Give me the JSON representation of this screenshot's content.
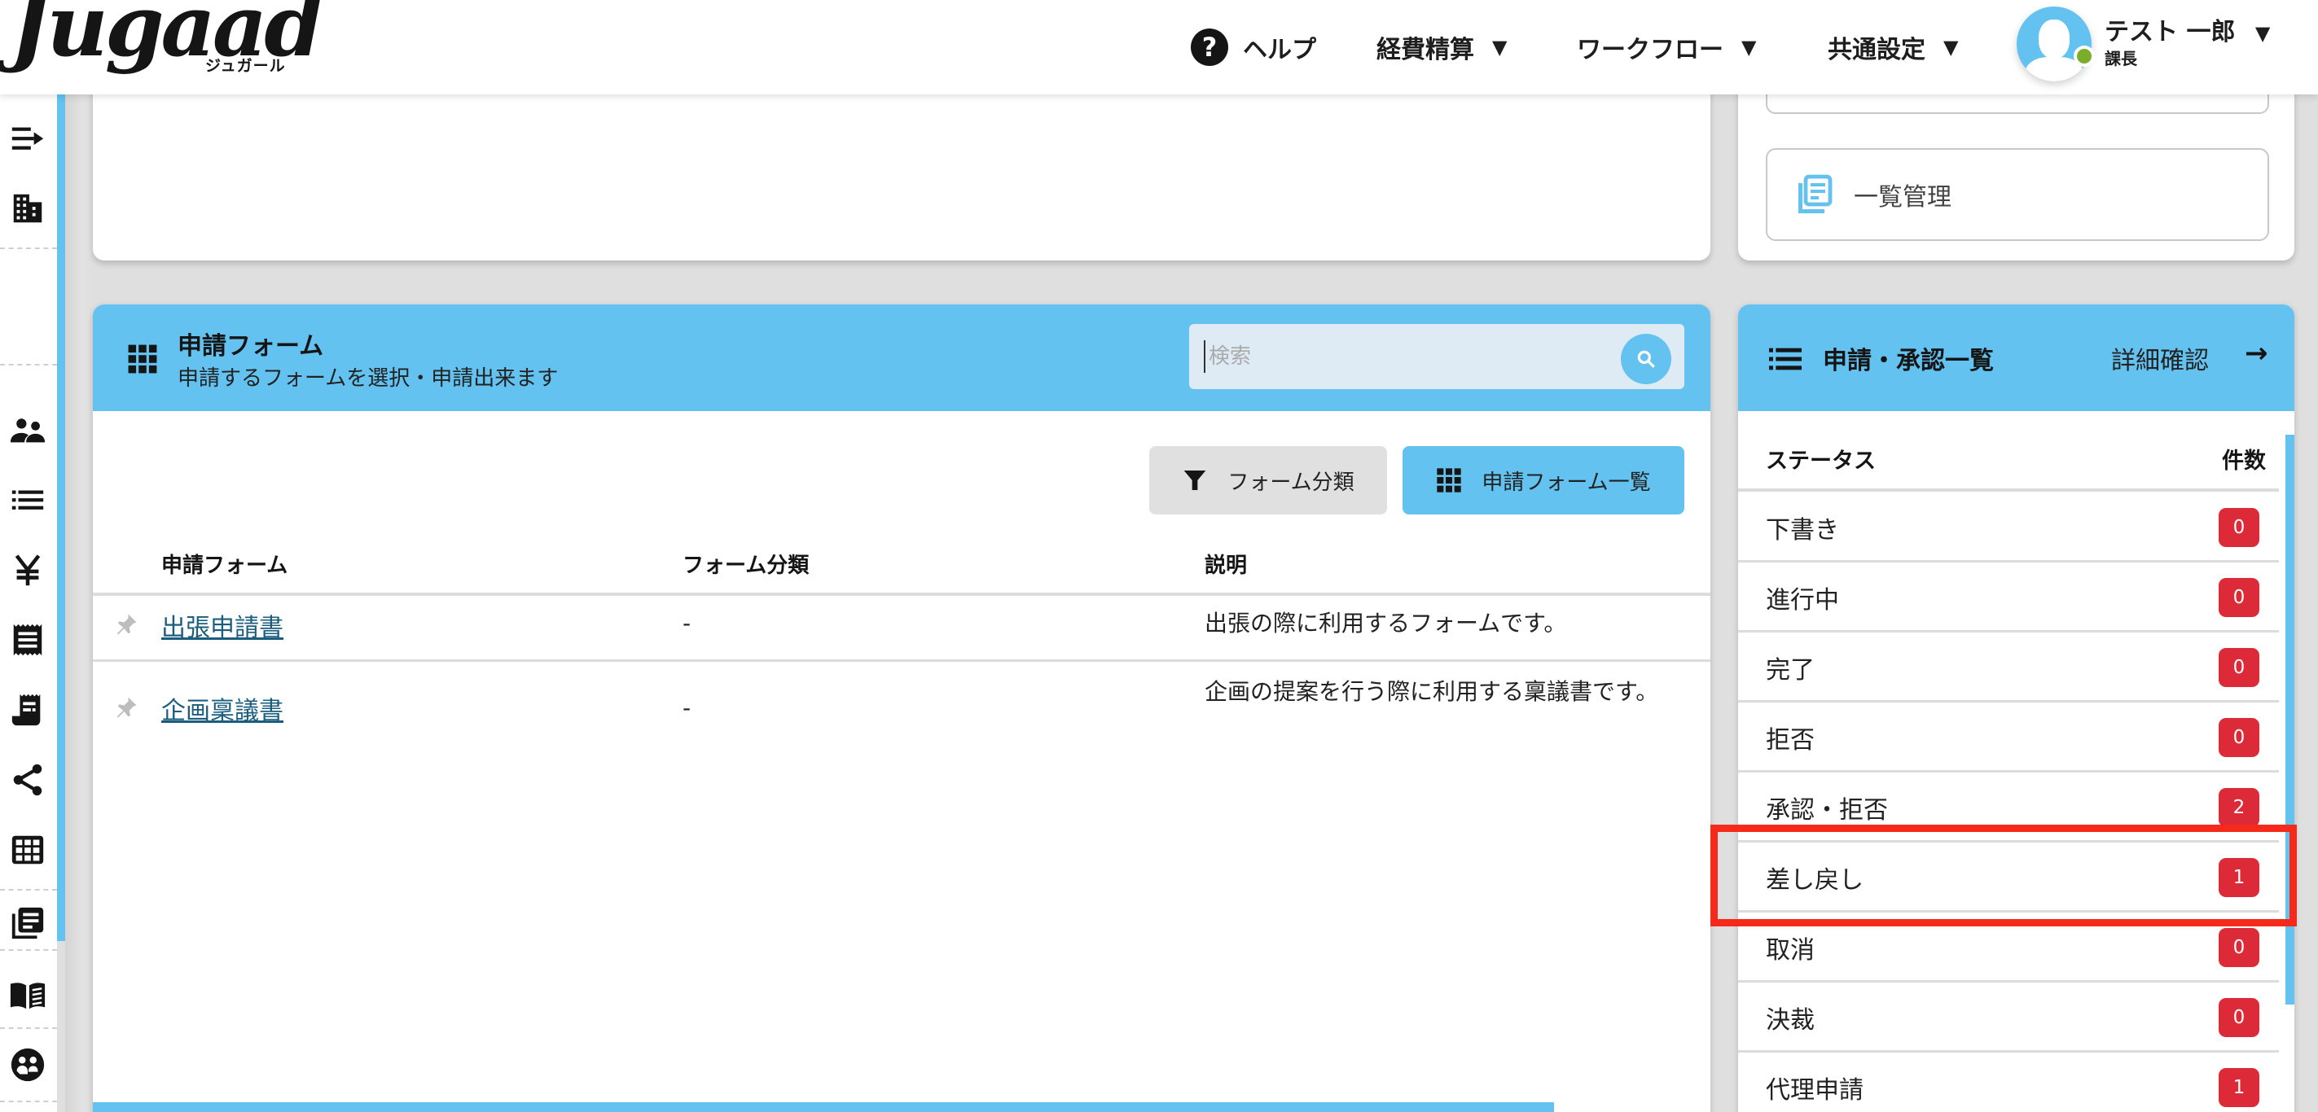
{
  "header": {
    "logo_text": "Jugaad",
    "logo_sub": "ジュガール",
    "nav": {
      "help": "ヘルプ",
      "expense": "経費精算",
      "workflow": "ワークフロー",
      "common_settings": "共通設定"
    },
    "caret": "▼",
    "user": {
      "name": "テスト 一郎",
      "role": "課長",
      "status_color": "#7aae2a"
    }
  },
  "sidebar": {
    "icons": [
      "collapse-menu",
      "building",
      "users",
      "list",
      "yen",
      "receipt",
      "receipt-long",
      "share",
      "grid",
      "library-books",
      "manual-book",
      "user-group-circle"
    ]
  },
  "top_right_card": {
    "tile_partial": "",
    "tile_list": "一覧管理"
  },
  "form_panel": {
    "title": "申請フォーム",
    "subtitle": "申請するフォームを選択・申請出来ます",
    "search": {
      "placeholder": "検索",
      "value": ""
    },
    "buttons": {
      "filter": "フォーム分類",
      "list": "申請フォーム一覧"
    },
    "columns": [
      "申請フォーム",
      "フォーム分類",
      "説明"
    ],
    "rows": [
      {
        "name": "出張申請書",
        "category": "-",
        "description": "出張の際に利用するフォームです。"
      },
      {
        "name": "企画稟議書",
        "category": "-",
        "description": "企画の提案を行う際に利用する稟議書です。"
      }
    ]
  },
  "status_panel": {
    "title": "申請・承認一覧",
    "detail_link": "詳細確認",
    "arrow": "→",
    "columns": {
      "status": "ステータス",
      "count": "件数"
    },
    "rows": [
      {
        "label": "下書き",
        "count": "0"
      },
      {
        "label": "進行中",
        "count": "0"
      },
      {
        "label": "完了",
        "count": "0"
      },
      {
        "label": "拒否",
        "count": "0"
      },
      {
        "label": "承認・拒否",
        "count": "2"
      },
      {
        "label": "差し戻し",
        "count": "1",
        "highlighted": true
      },
      {
        "label": "取消",
        "count": "0"
      },
      {
        "label": "決裁",
        "count": "0"
      },
      {
        "label": "代理申請",
        "count": "1"
      }
    ]
  },
  "colors": {
    "accent": "#63c2ef",
    "badge": "#dc2a38",
    "highlight_box": "#f52a1b",
    "link": "#1a5d7e"
  }
}
